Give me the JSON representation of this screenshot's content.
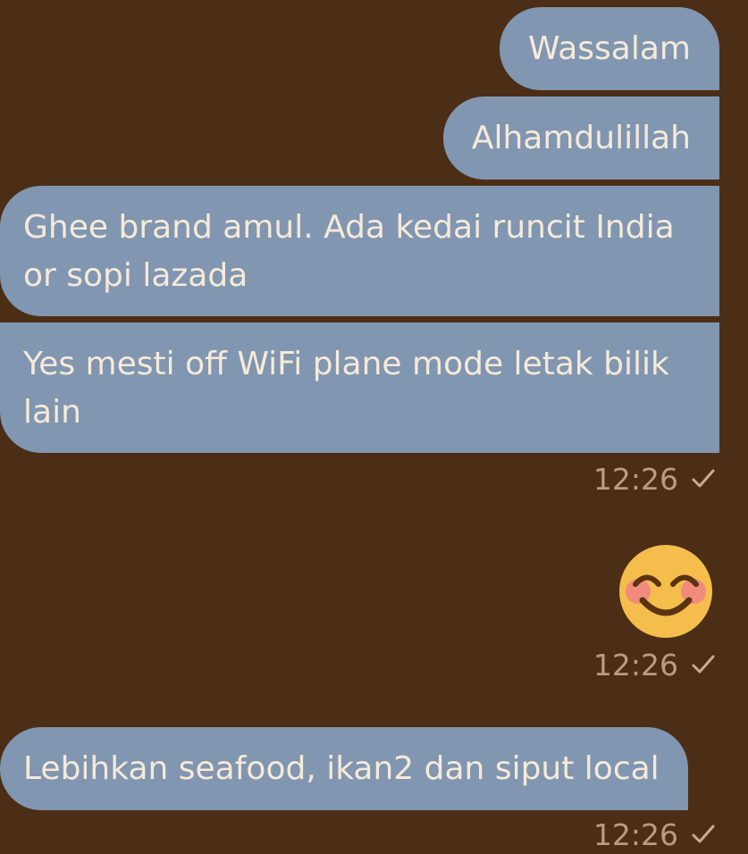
{
  "messages": [
    {
      "text": "Wassalam"
    },
    {
      "text": "Alhamdulillah"
    },
    {
      "text": "Ghee brand amul. Ada kedai runcit India or sopi lazada"
    },
    {
      "text": "Yes mesti off WiFi plane mode letak bilik lain"
    },
    {
      "emoji": "smiling-face-with-smiling-eyes",
      "time": "12:26"
    },
    {
      "text": "Lebihkan seafood, ikan2 dan siput local"
    }
  ],
  "timestamps": [
    "12:26",
    "12:26",
    "12:26"
  ],
  "colors": {
    "background": "#4b2e15",
    "bubble": "#8196b0",
    "bubble_text": "#f6ead9",
    "meta_text": "#b99d82"
  },
  "icons": {
    "status": "check-icon",
    "emoji": "smiling-face-emoji"
  }
}
